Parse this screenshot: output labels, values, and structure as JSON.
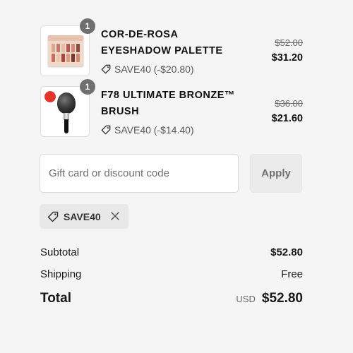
{
  "items": [
    {
      "quantity": "1",
      "name_line1": "COR-DE-ROSA",
      "name_line2": "EYESHADOW PALETTE",
      "discount": "SAVE40 (-$20.80)",
      "original_price": "$52.00",
      "price": "$31.20",
      "image_icon": "eyeshadow-palette-image"
    },
    {
      "quantity": "1",
      "name_line1": "F78 ULTIMATE BRONZE™",
      "name_line2": "BRUSH",
      "discount": "SAVE40 (-$14.40)",
      "original_price": "$36.00",
      "price": "$21.60",
      "image_icon": "makeup-brush-image"
    }
  ],
  "discount_form": {
    "placeholder": "Gift card or discount code",
    "value": "",
    "apply_label": "Apply"
  },
  "applied_code": {
    "code": "SAVE40",
    "icons": [
      "tag-icon",
      "close-icon"
    ]
  },
  "summary": {
    "subtotal_label": "Subtotal",
    "subtotal_value": "$52.80",
    "shipping_label": "Shipping",
    "shipping_value": "Free",
    "total_label": "Total",
    "currency": "USD",
    "total_value": "$52.80"
  },
  "colors": {
    "background": "#f5f5f5",
    "badge": "#6f6f6f",
    "muted_text": "#6b6b6b",
    "button_bg": "#ebebeb",
    "chip_bg": "#e8e8e8"
  }
}
